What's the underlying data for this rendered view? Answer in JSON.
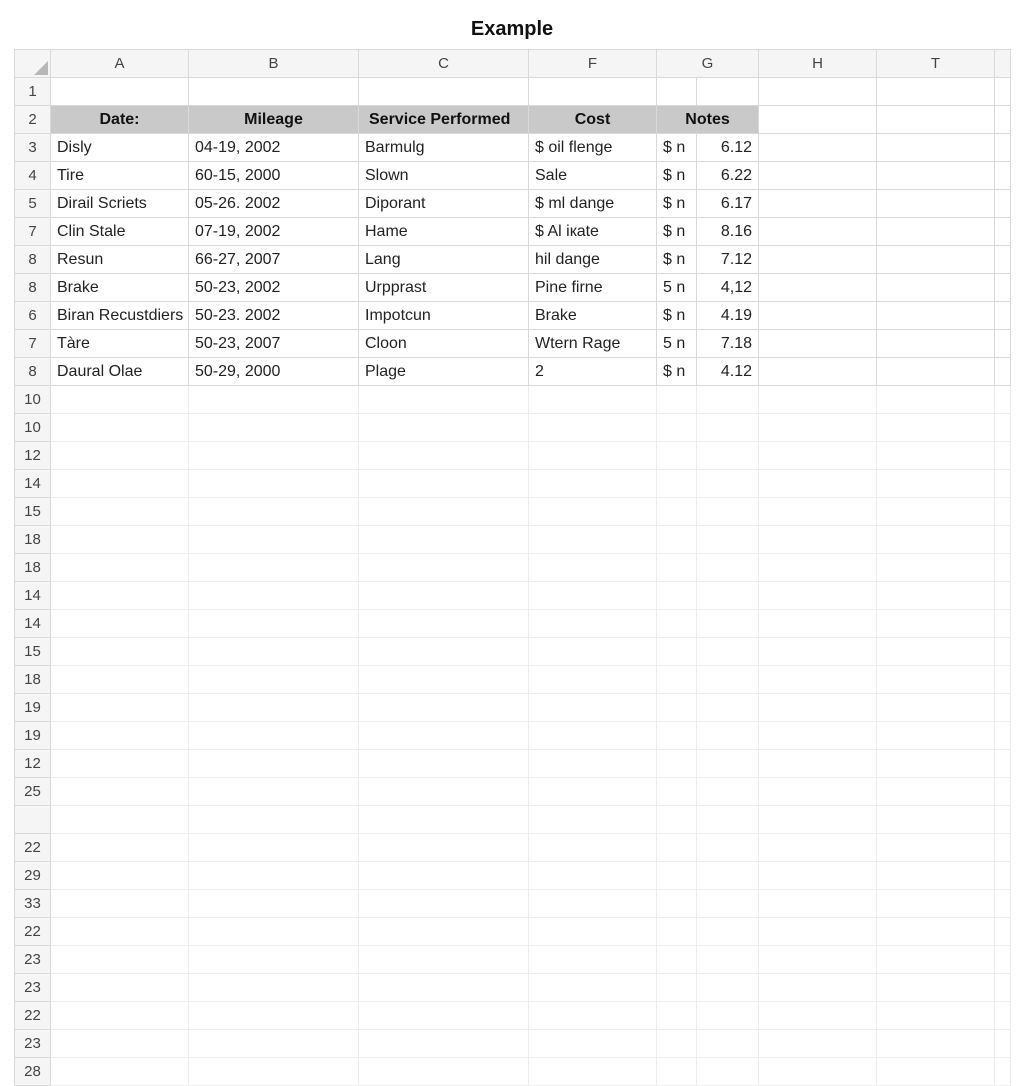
{
  "title": "Example",
  "columns": [
    "A",
    "B",
    "C",
    "F",
    "G",
    "H",
    "T"
  ],
  "headerRow": {
    "rowLabel": "2",
    "date": "Date:",
    "mileage": "Mileage",
    "service": "Service Performed",
    "cost": "Cost",
    "notes": "Notes"
  },
  "firstEmptyRowLabel": "1",
  "dataRows": [
    {
      "rowLabel": "3",
      "a": "Disly",
      "b": "04-19, 2002",
      "c": "Barmulg",
      "f": "$ oil flenge",
      "g1": "$ n",
      "g2": "6.12"
    },
    {
      "rowLabel": "4",
      "a": "Tire",
      "b": "60-15, 2000",
      "c": "Slown",
      "f": "Sale",
      "g1": "$ n",
      "g2": "6.22"
    },
    {
      "rowLabel": "5",
      "a": "Dirail Scriets",
      "b": "05-26. 2002",
      "c": "Diporant",
      "f": "$ ml dange",
      "g1": "$ n",
      "g2": "6.17"
    },
    {
      "rowLabel": "7",
      "a": "Clin Stale",
      "b": "07-19, 2002",
      "c": "Hame",
      "f": "$ Al iкate",
      "g1": "$ n",
      "g2": "8.16"
    },
    {
      "rowLabel": "8",
      "a": "Resun",
      "b": "66-27, 2007",
      "c": "Lang",
      "f": "hil dange",
      "g1": "$ n",
      "g2": "7.12"
    },
    {
      "rowLabel": "8",
      "a": "Brake",
      "b": "50-23, 2002",
      "c": "Urpprast",
      "f": "Pine firne",
      "g1": "5 n",
      "g2": "4,12"
    },
    {
      "rowLabel": "6",
      "a": "Biran Recustdiers",
      "b": "50-23. 2002",
      "c": "Impotcun",
      "f": "Brake",
      "g1": "$ n",
      "g2": "4.19"
    },
    {
      "rowLabel": "7",
      "a": "Tàre",
      "b": "50-23, 2007",
      "c": "Cloon",
      "f": "Wtern Rage",
      "g1": "5 n",
      "g2": "7.18"
    },
    {
      "rowLabel": "8",
      "a": "Daural Olae",
      "b": "50-29, 2000",
      "c": "Plage",
      "f": "2",
      "g1": "$ n",
      "g2": "4.12"
    }
  ],
  "emptyRowLabels": [
    "10",
    "10",
    "12",
    "14",
    "15",
    "18",
    "18",
    "14",
    "14",
    "15",
    "18",
    "19",
    "19",
    "12",
    "25",
    "",
    "22",
    "29",
    "33",
    "22",
    "23",
    "23",
    "22",
    "23",
    "28"
  ]
}
